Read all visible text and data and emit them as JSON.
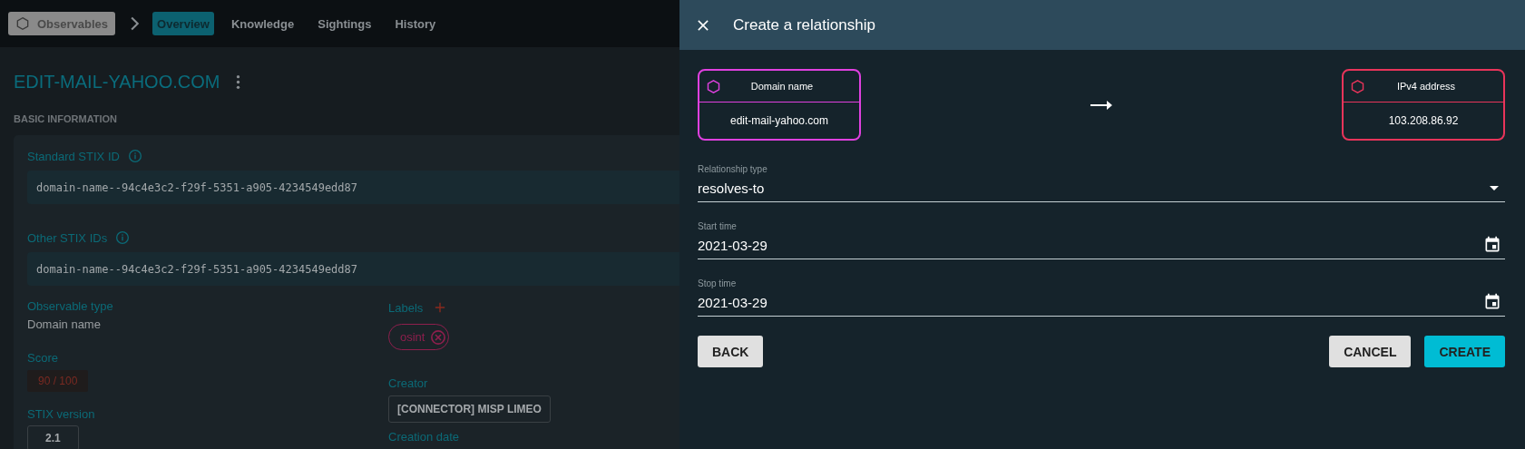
{
  "topbar": {
    "entity_button": "Observables",
    "tabs": [
      {
        "label": "Overview",
        "selected": true
      },
      {
        "label": "Knowledge",
        "selected": false
      },
      {
        "label": "Sightings",
        "selected": false
      },
      {
        "label": "History",
        "selected": false
      }
    ]
  },
  "entity": {
    "title": "EDIT-MAIL-YAHOO.COM",
    "section": "BASIC INFORMATION",
    "standard_stix_id": {
      "label": "Standard STIX ID",
      "value": "domain-name--94c4e3c2-f29f-5351-a905-4234549edd87"
    },
    "other_stix_ids": {
      "label": "Other STIX IDs",
      "value": "domain-name--94c4e3c2-f29f-5351-a905-4234549edd87"
    },
    "observable_type": {
      "label": "Observable type",
      "value": "Domain name"
    },
    "score": {
      "label": "Score",
      "value": "90 / 100"
    },
    "stix_version": {
      "label": "STIX version",
      "value": "2.1"
    },
    "labels": {
      "label": "Labels",
      "items": [
        {
          "text": "osint",
          "color": "#8e1f4d"
        }
      ]
    },
    "creator": {
      "label": "Creator",
      "value": "[CONNECTOR] MISP LIMEO"
    },
    "creation_date": {
      "label": "Creation date"
    }
  },
  "drawer": {
    "title": "Create a relationship",
    "from": {
      "type": "Domain name",
      "name": "edit-mail-yahoo.com",
      "color": "#e040e0"
    },
    "to": {
      "type": "IPv4 address",
      "name": "103.208.86.92",
      "color": "#e8345a"
    },
    "relationship_type": {
      "label": "Relationship type",
      "value": "resolves-to"
    },
    "start_time": {
      "label": "Start time",
      "value": "2021-03-29"
    },
    "stop_time": {
      "label": "Stop time",
      "value": "2021-03-29"
    },
    "left_buttons": [
      {
        "label": "BACK",
        "kind": "default"
      }
    ],
    "right_buttons": [
      {
        "label": "CANCEL",
        "kind": "default"
      },
      {
        "label": "CREATE",
        "kind": "primary"
      }
    ]
  }
}
